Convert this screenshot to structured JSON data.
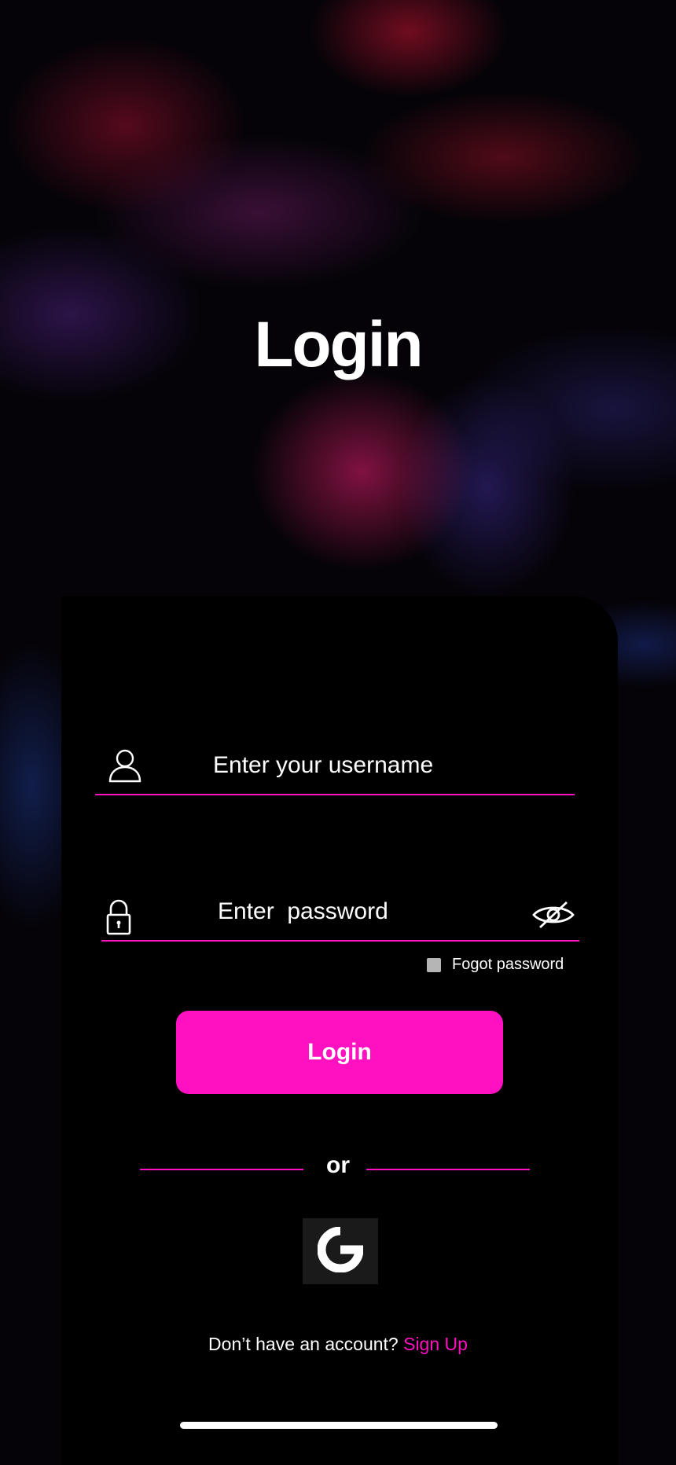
{
  "screen": {
    "title": "Login"
  },
  "form": {
    "username": {
      "placeholder": "Enter your username",
      "value": ""
    },
    "password": {
      "placeholder": "Enter  password",
      "value": ""
    },
    "forgot_label": "Fogot password",
    "login_button": "Login",
    "divider_text": "or",
    "google_button_icon": "google-icon",
    "signup_prompt": "Don’t have an account?",
    "signup_link": "Sign Up"
  },
  "icons": {
    "username": "user-icon",
    "password": "lock-icon",
    "visibility": "eye-slash-icon"
  },
  "colors": {
    "accent": "#ff10c0",
    "background": "#000000",
    "text": "#ffffff",
    "checkbox": "#b5b5b5"
  }
}
